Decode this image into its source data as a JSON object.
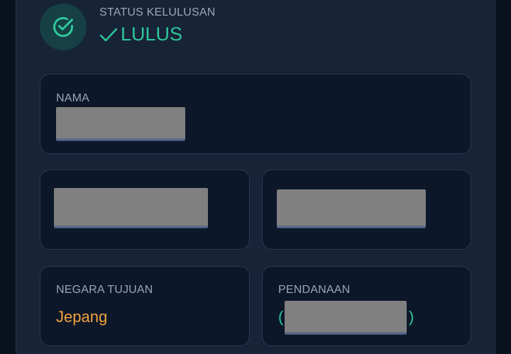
{
  "status": {
    "label": "STATUS KELULUSAN",
    "value": "LULUS",
    "icon": "check-circle-icon",
    "color": "#2ec79a"
  },
  "cards": {
    "nama": {
      "label": "NAMA",
      "value_redacted": true
    },
    "field_2": {
      "value_redacted": true
    },
    "field_3": {
      "value_redacted": true
    },
    "negara_tujuan": {
      "label": "NEGARA TUJUAN",
      "value": "Jepang",
      "value_color": "#f2a33b"
    },
    "pendanaan": {
      "label": "PENDANAAN",
      "paren_open": "(",
      "paren_close": ")",
      "value_redacted": true
    }
  }
}
